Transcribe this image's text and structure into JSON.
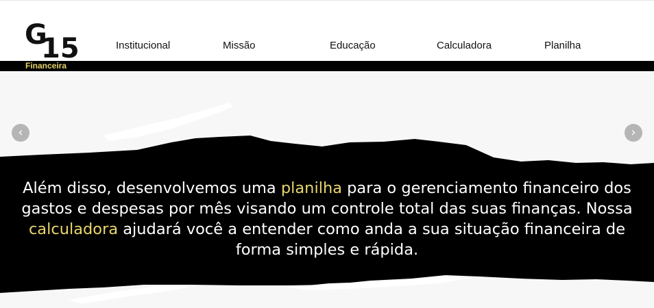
{
  "logo": {
    "top_text": "G",
    "number": "15",
    "subtitle": "Financeira"
  },
  "nav": {
    "items": [
      {
        "label": "Institucional"
      },
      {
        "label": "Missão"
      },
      {
        "label": "Educação"
      },
      {
        "label": "Calculadora"
      },
      {
        "label": "Planilha"
      }
    ]
  },
  "carousel": {
    "prev_icon": "chevron-left-icon",
    "next_icon": "chevron-right-icon",
    "prev_glyph": "‹",
    "next_glyph": "›",
    "slide": {
      "part1": "Além disso, desenvolvemos uma ",
      "highlight1": "planilha",
      "part2": " para o gerenciamento financeiro dos gastos e despesas por mês visando um controle total das suas finanças. Nossa ",
      "highlight2": "calculadora",
      "part3": " ajudará você a entender como anda a sua situação financeira de forma simples e rápida."
    }
  },
  "colors": {
    "accent": "#e8d66c",
    "header_bar": "#000000",
    "band": "#000000",
    "background": "#f7f7f7",
    "arrow": "#b5b5b5"
  }
}
